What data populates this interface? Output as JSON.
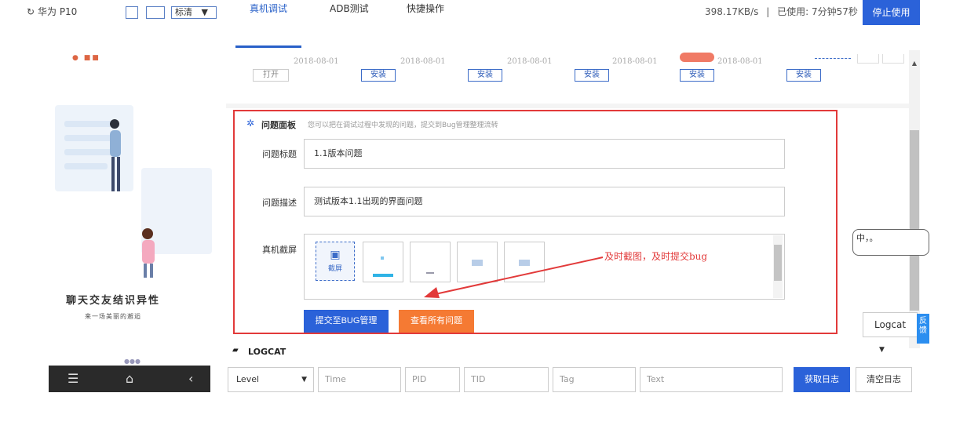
{
  "device": {
    "name": "华为 P10",
    "quality": "标清"
  },
  "tabs": [
    {
      "label": "真机调试"
    },
    {
      "label": "ADB测试"
    },
    {
      "label": "快捷操作"
    }
  ],
  "status": {
    "speed": "398.17KB/s",
    "separator": "|",
    "used": "已使用: 7分钟57秒",
    "stop_label": "停止使用"
  },
  "phone": {
    "slogan": "聊天交友结识异性",
    "slogan_sub": "来一场美丽的邂逅"
  },
  "apps": {
    "dates": [
      "2018-08-01",
      "2018-08-01",
      "2018-08-01",
      "2018-08-01",
      "2018-08-01"
    ],
    "open_label": "打开",
    "install_label": "安装"
  },
  "panel": {
    "title": "问题面板",
    "tip": "您可以把在调试过程中发现的问题，提交到Bug管理整理流转",
    "title_label": "问题标题",
    "title_value": "1.1版本问题",
    "desc_label": "问题描述",
    "desc_value": "测试版本1.1出现的界面问题",
    "shot_label": "真机截屏",
    "shot_btn": "截屏",
    "submit_label": "提交至BUG管理",
    "view_label": "查看所有问题",
    "annotation": "及时截图，及时提交bug"
  },
  "logcat": {
    "title": "LOGCAT",
    "level": "Level",
    "placeholders": {
      "time": "Time",
      "pid": "PID",
      "tid": "TID",
      "tag": "Tag",
      "text": "Text"
    },
    "get_label": "获取日志",
    "clear_label": "清空日志",
    "select": "Logcat"
  },
  "feedback": "反馈",
  "ime": "中，。",
  "colors": {
    "accent": "#2b62d9",
    "orange": "#f57a33",
    "highlight": "#e23a3a"
  }
}
